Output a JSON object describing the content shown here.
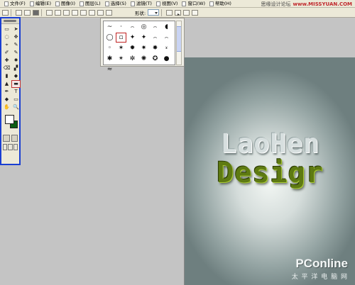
{
  "menubar": {
    "items": [
      "文件(F)",
      "编辑(E)",
      "图像(I)",
      "图层(L)",
      "选择(S)",
      "滤镜(T)",
      "视图(V)",
      "窗口(W)",
      "帮助(H)"
    ]
  },
  "watermark_top": {
    "left": "思缘设计论坛",
    "right": "www.MISSYUAN.COM"
  },
  "options_bar": {
    "shape_label": "形状:"
  },
  "toolbox": {
    "tools": [
      "▭",
      "➤",
      "◌",
      "✥",
      "⌖",
      "✎",
      "✐",
      "✎",
      "✚",
      "✹",
      "⌫",
      "▞",
      "▮",
      "◆",
      "▲",
      "▬",
      "✒",
      "T",
      "◆",
      "▭",
      "✋",
      "🔍"
    ],
    "foreground_color": "#ffffff",
    "background_color": "#0c5c14"
  },
  "shape_picker": {
    "cells": [
      "~",
      "·",
      "⌢",
      "◎",
      "⌢",
      "◖",
      "◯",
      "▫",
      "✦",
      "✦",
      "⌢",
      "⌢",
      "◦",
      "✶",
      "✹",
      "✷",
      "✸",
      "⍣",
      "✱",
      "✴",
      "✼",
      "✺",
      "✪",
      "●",
      "≈"
    ],
    "selected_index": 7
  },
  "canvas": {
    "line1": "LaoHen",
    "line2": "Desigr",
    "logo": "PConline",
    "logo_sub": "太 平 洋 电 脑 网"
  }
}
